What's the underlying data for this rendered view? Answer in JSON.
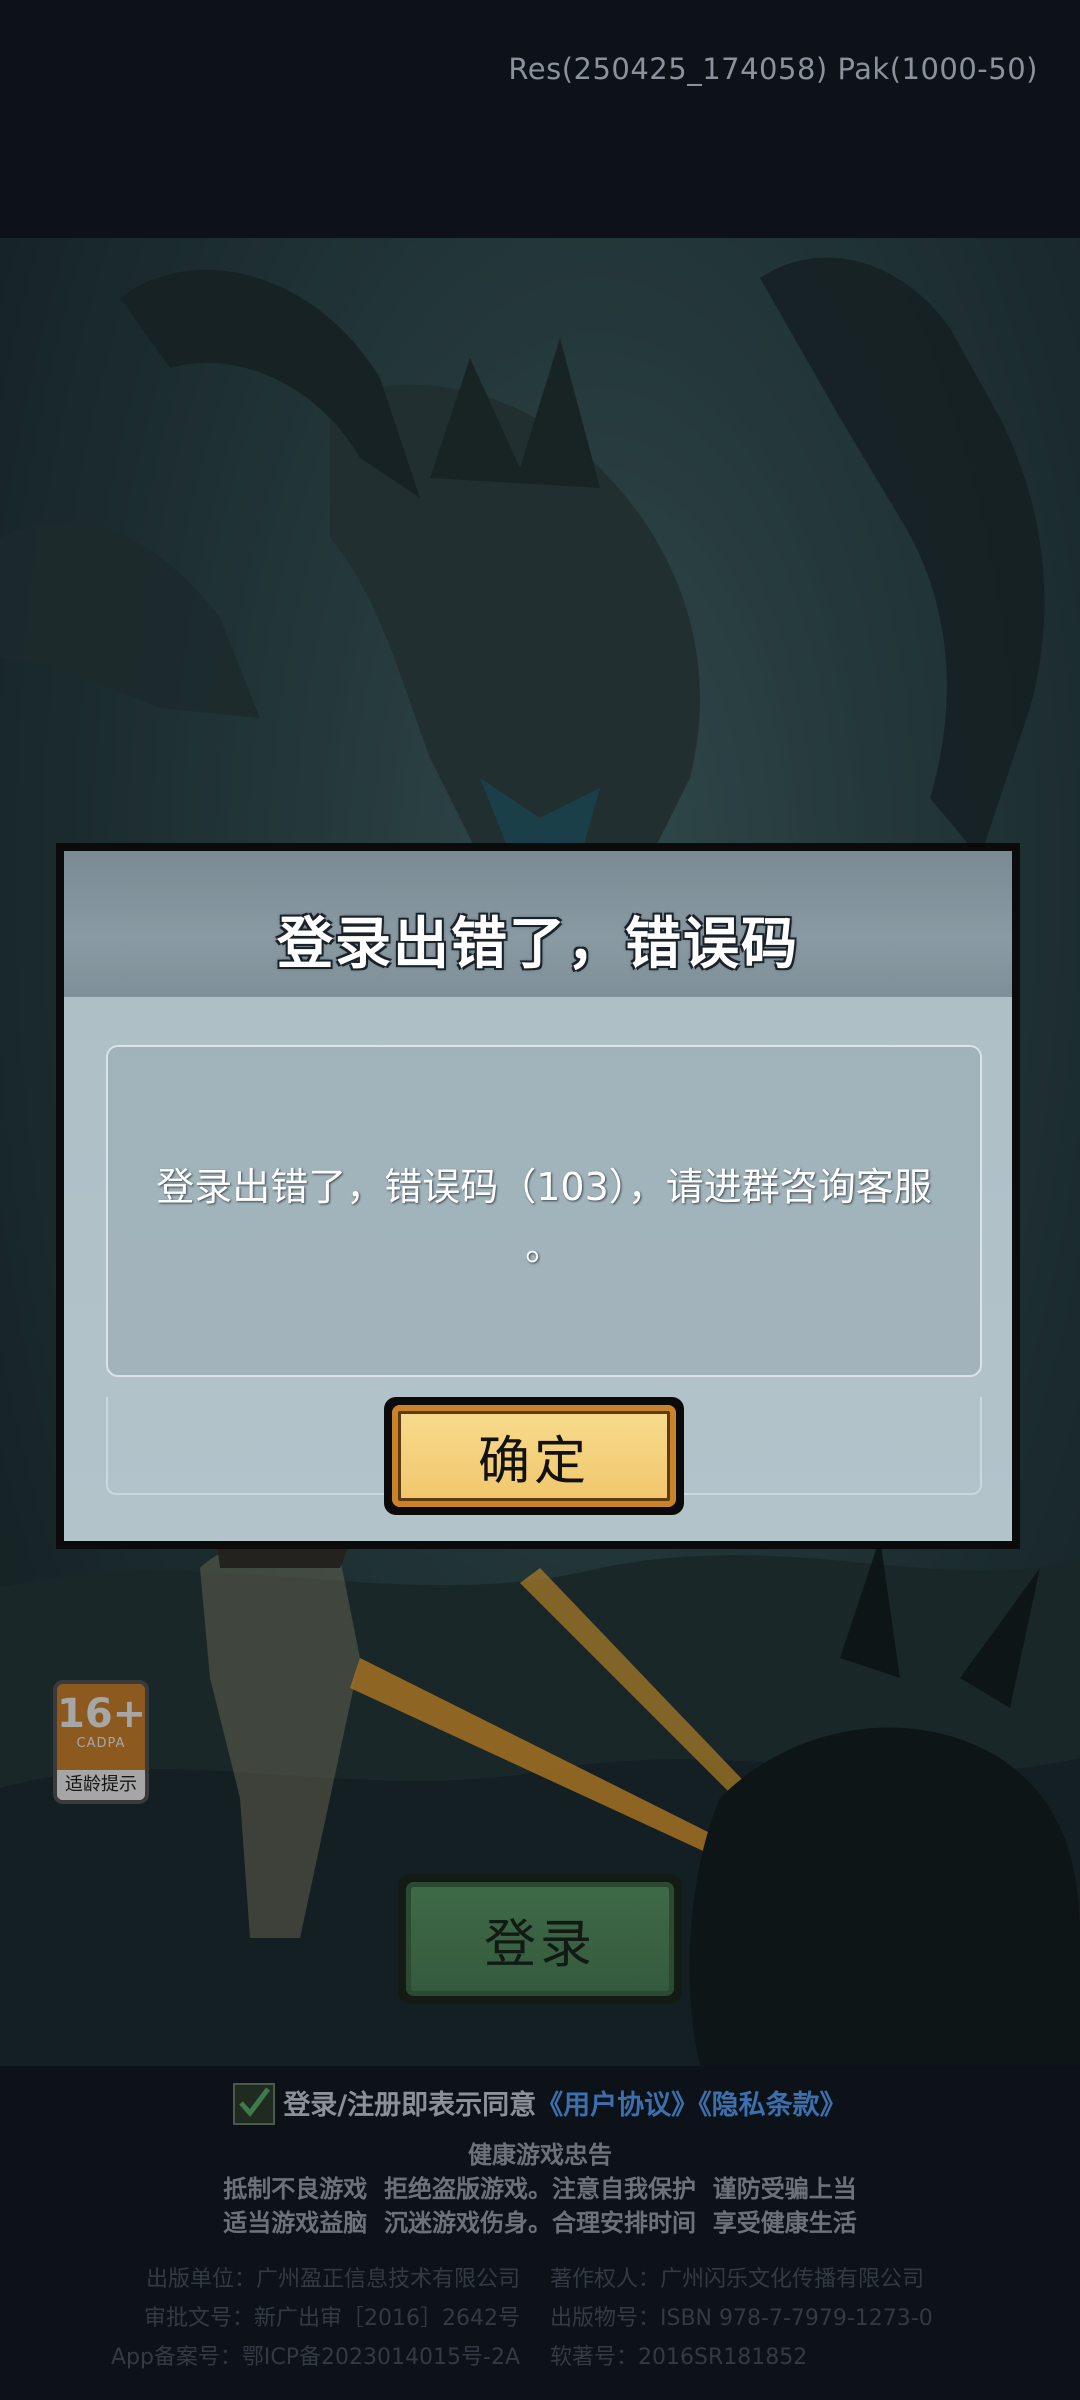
{
  "version_text": "Res(250425_174058) Pak(1000-50)",
  "dialog": {
    "title": "登录出错了，错误码",
    "message_line1": "登录出错了，错误码（103），请进群咨询客服",
    "message_line2": "。",
    "confirm_label": "确定"
  },
  "age_badge": {
    "number": "16+",
    "org": "CADPA",
    "tip": "适龄提示"
  },
  "login_button": {
    "label": "登录"
  },
  "agreement": {
    "checked": true,
    "prefix": "登录/注册即表示同意",
    "user_agreement": "《用户协议》",
    "privacy": "《隐私条款》"
  },
  "health_notice": {
    "title": "健康游戏忠告",
    "line1": "抵制不良游戏  拒绝盗版游戏。注意自我保护  谨防受骗上当",
    "line2": "适当游戏益脑  沉迷游戏伤身。合理安排时间  享受健康生活"
  },
  "publishing": {
    "left": [
      "出版单位：广州盈正信息技术有限公司",
      "审批文号：新广出审［2016］2642号",
      "App备案号：鄂ICP备2023014015号-2A"
    ],
    "right": [
      "著作权人：广州闪乐文化传播有限公司",
      "出版物号：ISBN 978-7-7979-1273-0",
      "软著号：2016SR181852"
    ]
  },
  "colors": {
    "background": "#0d1118",
    "confirm_button": "#f0c56a",
    "login_button": "#3f6a48",
    "link": "#3b6fae",
    "age_badge": "#d8892f"
  }
}
